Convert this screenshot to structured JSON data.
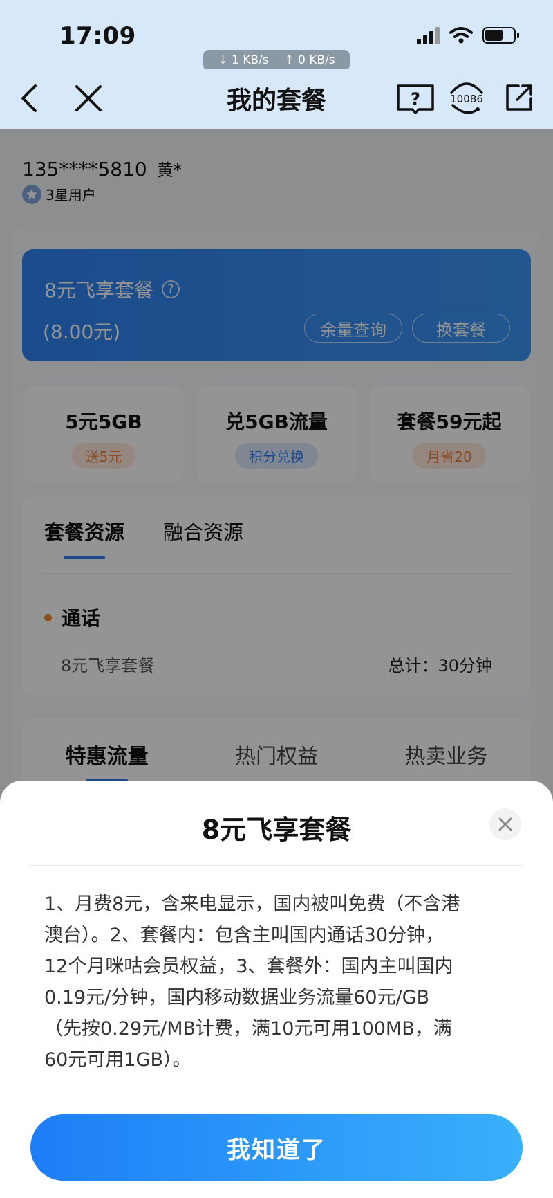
{
  "status_bar": {
    "time": "17:09",
    "download_speed": "↓ 1 KB/s",
    "upload_speed": "↑ 0 KB/s",
    "icons": [
      "signal-icon",
      "wifi-icon",
      "battery-icon"
    ]
  },
  "nav": {
    "title": "我的套餐",
    "icons": [
      "back-icon",
      "close-icon",
      "help-book-icon",
      "customer-service-icon",
      "share-icon"
    ],
    "service_number": "10086"
  },
  "user": {
    "phone": "135****5810",
    "name": "黄*",
    "level": "3星用户"
  },
  "plan_card": {
    "name": "8元飞享套餐",
    "help": "?",
    "fee": "(8.00元)",
    "balance_button": "余量查询",
    "change_button": "换套餐",
    "color": "#2f82f0"
  },
  "promos": [
    {
      "title": "5元5GB",
      "tag": "送5元",
      "tag_color": "#f07f3c"
    },
    {
      "title": "兑5GB流量",
      "tag": "积分兑换",
      "tag_color": "#2f7ef0"
    },
    {
      "title": "套餐59元起",
      "tag": "月省20",
      "tag_color": "#f07f3c"
    }
  ],
  "resources": {
    "tabs": [
      "套餐资源",
      "融合资源"
    ],
    "section": "通话",
    "item_name": "8元飞享套餐",
    "item_total": "总计：30分钟"
  },
  "bottom_tabs": [
    "特惠流量",
    "热门权益",
    "热卖业务"
  ],
  "sheet": {
    "title": "8元飞享套餐",
    "lines": [
      "1、月费8元，含来电显示，国内被叫免费（不含港",
      "澳台）。2、套餐内：包含主叫国内通话30分钟，",
      "12个月咪咕会员权益，3、套餐外：国内主叫国内",
      "0.19元/分钟，国内移动数据业务流量60元/GB",
      "（先按0.29元/MB计费，满10元可用100MB，满",
      "60元可用1GB）。"
    ],
    "confirm_button": "我知道了",
    "accent": "#1d7ef7"
  }
}
